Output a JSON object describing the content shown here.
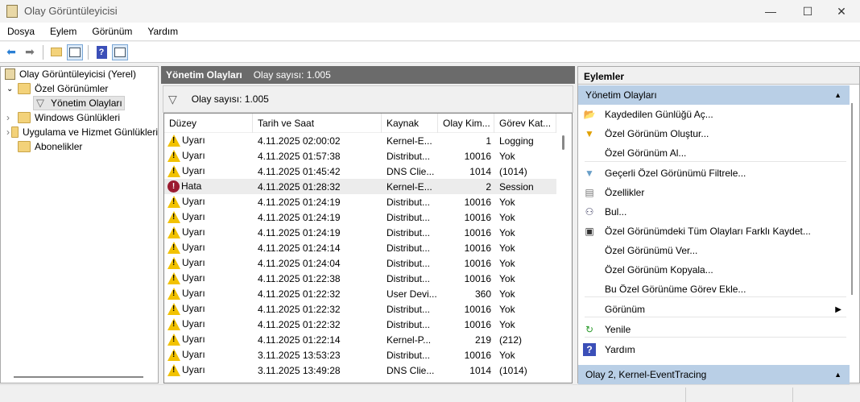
{
  "window": {
    "title": "Olay Görüntüleyicisi",
    "minimize": "—",
    "maximize": "☐",
    "close": "✕"
  },
  "menu": [
    "Dosya",
    "Eylem",
    "Görünüm",
    "Yardım"
  ],
  "tree": {
    "root": "Olay Görüntüleyicisi (Yerel)",
    "custom_views": "Özel Görünümler",
    "admin_events": "Yönetim Olayları",
    "windows_logs": "Windows Günlükleri",
    "app_logs": "Uygulama ve Hizmet Günlükleri",
    "subscriptions": "Abonelikler"
  },
  "center": {
    "title": "Yönetim Olayları",
    "count_header": "Olay sayısı: 1.005",
    "filter_count": "Olay sayısı: 1.005",
    "columns": [
      "Düzey",
      "Tarih ve Saat",
      "Kaynak",
      "Olay Kim...",
      "Görev Kat..."
    ],
    "rows": [
      [
        "warning",
        "Uyarı",
        "4.11.2025 02:00:02",
        "Kernel-E...",
        "1",
        "Logging"
      ],
      [
        "warning",
        "Uyarı",
        "4.11.2025 01:57:38",
        "Distribut...",
        "10016",
        "Yok"
      ],
      [
        "warning",
        "Uyarı",
        "4.11.2025 01:45:42",
        "DNS Clie...",
        "1014",
        "(1014)"
      ],
      [
        "error",
        "Hata",
        "4.11.2025 01:28:32",
        "Kernel-E...",
        "2",
        "Session"
      ],
      [
        "warning",
        "Uyarı",
        "4.11.2025 01:24:19",
        "Distribut...",
        "10016",
        "Yok"
      ],
      [
        "warning",
        "Uyarı",
        "4.11.2025 01:24:19",
        "Distribut...",
        "10016",
        "Yok"
      ],
      [
        "warning",
        "Uyarı",
        "4.11.2025 01:24:19",
        "Distribut...",
        "10016",
        "Yok"
      ],
      [
        "warning",
        "Uyarı",
        "4.11.2025 01:24:14",
        "Distribut...",
        "10016",
        "Yok"
      ],
      [
        "warning",
        "Uyarı",
        "4.11.2025 01:24:04",
        "Distribut...",
        "10016",
        "Yok"
      ],
      [
        "warning",
        "Uyarı",
        "4.11.2025 01:22:38",
        "Distribut...",
        "10016",
        "Yok"
      ],
      [
        "warning",
        "Uyarı",
        "4.11.2025 01:22:32",
        "User Devi...",
        "360",
        "Yok"
      ],
      [
        "warning",
        "Uyarı",
        "4.11.2025 01:22:32",
        "Distribut...",
        "10016",
        "Yok"
      ],
      [
        "warning",
        "Uyarı",
        "4.11.2025 01:22:32",
        "Distribut...",
        "10016",
        "Yok"
      ],
      [
        "warning",
        "Uyarı",
        "4.11.2025 01:22:14",
        "Kernel-P...",
        "219",
        "(212)"
      ],
      [
        "warning",
        "Uyarı",
        "3.11.2025 13:53:23",
        "Distribut...",
        "10016",
        "Yok"
      ],
      [
        "warning",
        "Uyarı",
        "3.11.2025 13:49:28",
        "DNS Clie...",
        "1014",
        "(1014)"
      ]
    ]
  },
  "actions": {
    "title": "Eylemler",
    "section1": "Yönetim Olayları",
    "section2": "Olay 2, Kernel-EventTracing",
    "items": [
      {
        "label": "Kaydedilen Günlüğü Aç...",
        "icon": "open-folder-icon"
      },
      {
        "label": "Özel Görünüm Oluştur...",
        "icon": "filter-create-icon"
      },
      {
        "label": "Özel Görünüm Al...",
        "icon": ""
      },
      {
        "label": "Geçerli Özel Görünümü Filtrele...",
        "icon": "filter-icon"
      },
      {
        "label": "Özellikler",
        "icon": "properties-icon"
      },
      {
        "label": "Bul...",
        "icon": "binoculars-icon"
      },
      {
        "label": "Özel Görünümdeki Tüm Olayları Farklı Kaydet...",
        "icon": "save-icon"
      },
      {
        "label": "Özel Görünümü Ver...",
        "icon": ""
      },
      {
        "label": "Özel Görünüm Kopyala...",
        "icon": ""
      },
      {
        "label": "Bu Özel Görünüme Görev Ekle...",
        "icon": ""
      },
      {
        "label": "Görünüm",
        "icon": ""
      },
      {
        "label": "Yenile",
        "icon": "refresh-icon"
      },
      {
        "label": "Yardım",
        "icon": "help-icon"
      }
    ]
  }
}
